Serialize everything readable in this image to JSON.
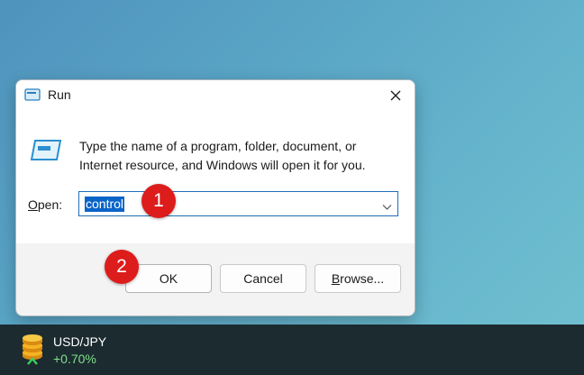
{
  "dialog": {
    "title": "Run",
    "description": "Type the name of a program, folder, document, or Internet resource, and Windows will open it for you.",
    "open_label_prefix": "O",
    "open_label_rest": "pen:",
    "open_value": "control",
    "buttons": {
      "ok": "OK",
      "cancel": "Cancel",
      "browse_prefix": "B",
      "browse_rest": "rowse..."
    }
  },
  "annotations": {
    "step1": "1",
    "step2": "2",
    "color": "#dd1c1c"
  },
  "taskbar": {
    "widget": {
      "name": "USD/JPY",
      "change": "+0.70%",
      "icon": "coins-icon"
    }
  },
  "colors": {
    "selection": "#0a64c8",
    "focus_border": "#1f6fb8",
    "change_positive": "#7ee08a"
  }
}
